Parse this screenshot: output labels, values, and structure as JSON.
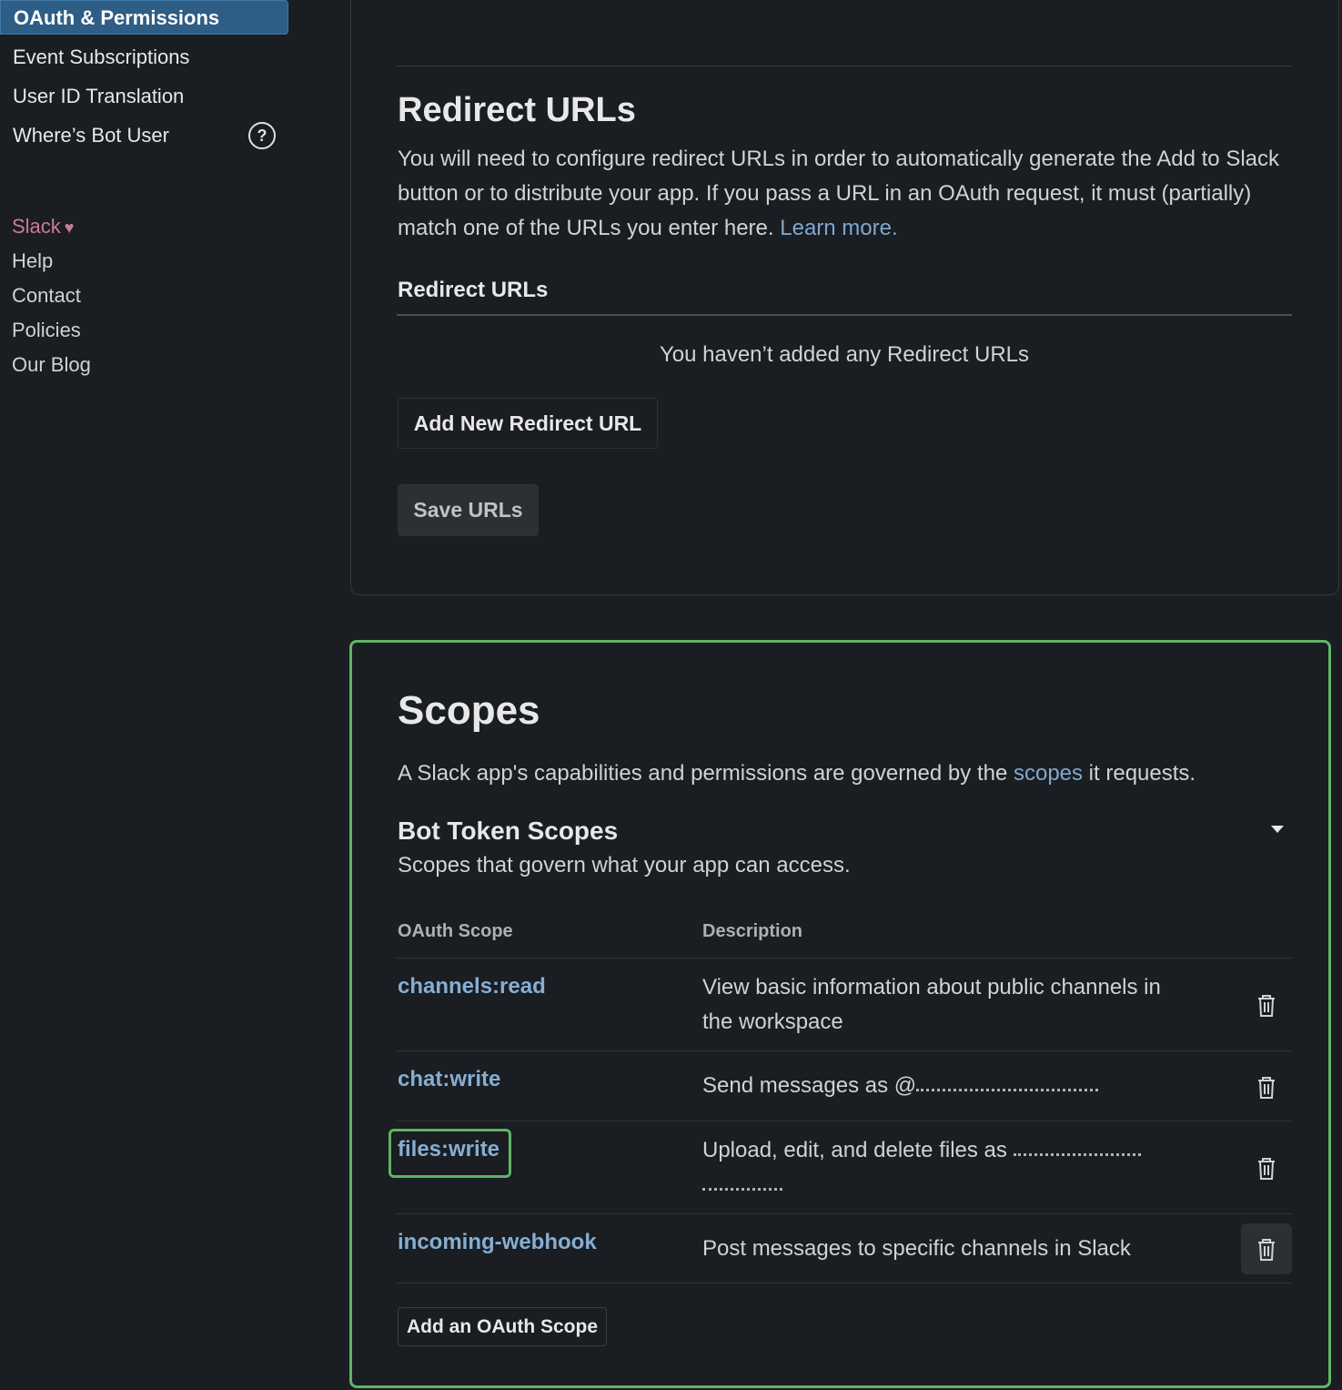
{
  "sidebar": {
    "nav": [
      {
        "label": "OAuth & Permissions"
      },
      {
        "label": "Event Subscriptions"
      },
      {
        "label": "User ID Translation"
      },
      {
        "label": "Where’s Bot User"
      }
    ],
    "help_glyph": "?",
    "footer": {
      "slack": "Slack",
      "links": [
        "Help",
        "Contact",
        "Policies",
        "Our Blog"
      ]
    }
  },
  "redirect": {
    "title": "Redirect URLs",
    "description": "You will need to configure redirect URLs in order to automatically generate the Add to Slack button or to distribute your app. If you pass a URL in an OAuth request, it must (partially) match one of the URLs you enter here.",
    "learn_more": "Learn more.",
    "list_heading": "Redirect URLs",
    "empty_message": "You haven’t added any Redirect URLs",
    "add_button": "Add New Redirect URL",
    "save_button": "Save URLs"
  },
  "scopes": {
    "title": "Scopes",
    "intro_before": "A Slack app's capabilities and permissions are governed by the ",
    "intro_link": "scopes",
    "intro_after": " it requests.",
    "bot_heading": "Bot Token Scopes",
    "bot_sub": "Scopes that govern what your app can access.",
    "columns": {
      "scope": "OAuth Scope",
      "description": "Description"
    },
    "rows": [
      {
        "scope": "channels:read",
        "description": "View basic information about public channels in the workspace"
      },
      {
        "scope": "chat:write",
        "description": "Send messages as @"
      },
      {
        "scope": "files:write",
        "description": "Upload, edit, and delete files as"
      },
      {
        "scope": "incoming-webhook",
        "description": "Post messages to specific channels in Slack"
      }
    ],
    "add_button": "Add an OAuth Scope"
  },
  "colors": {
    "background": "#1a1d21",
    "accent_link": "#86aed3",
    "highlight": "#5fb463",
    "active_nav": "#2e5d85"
  }
}
